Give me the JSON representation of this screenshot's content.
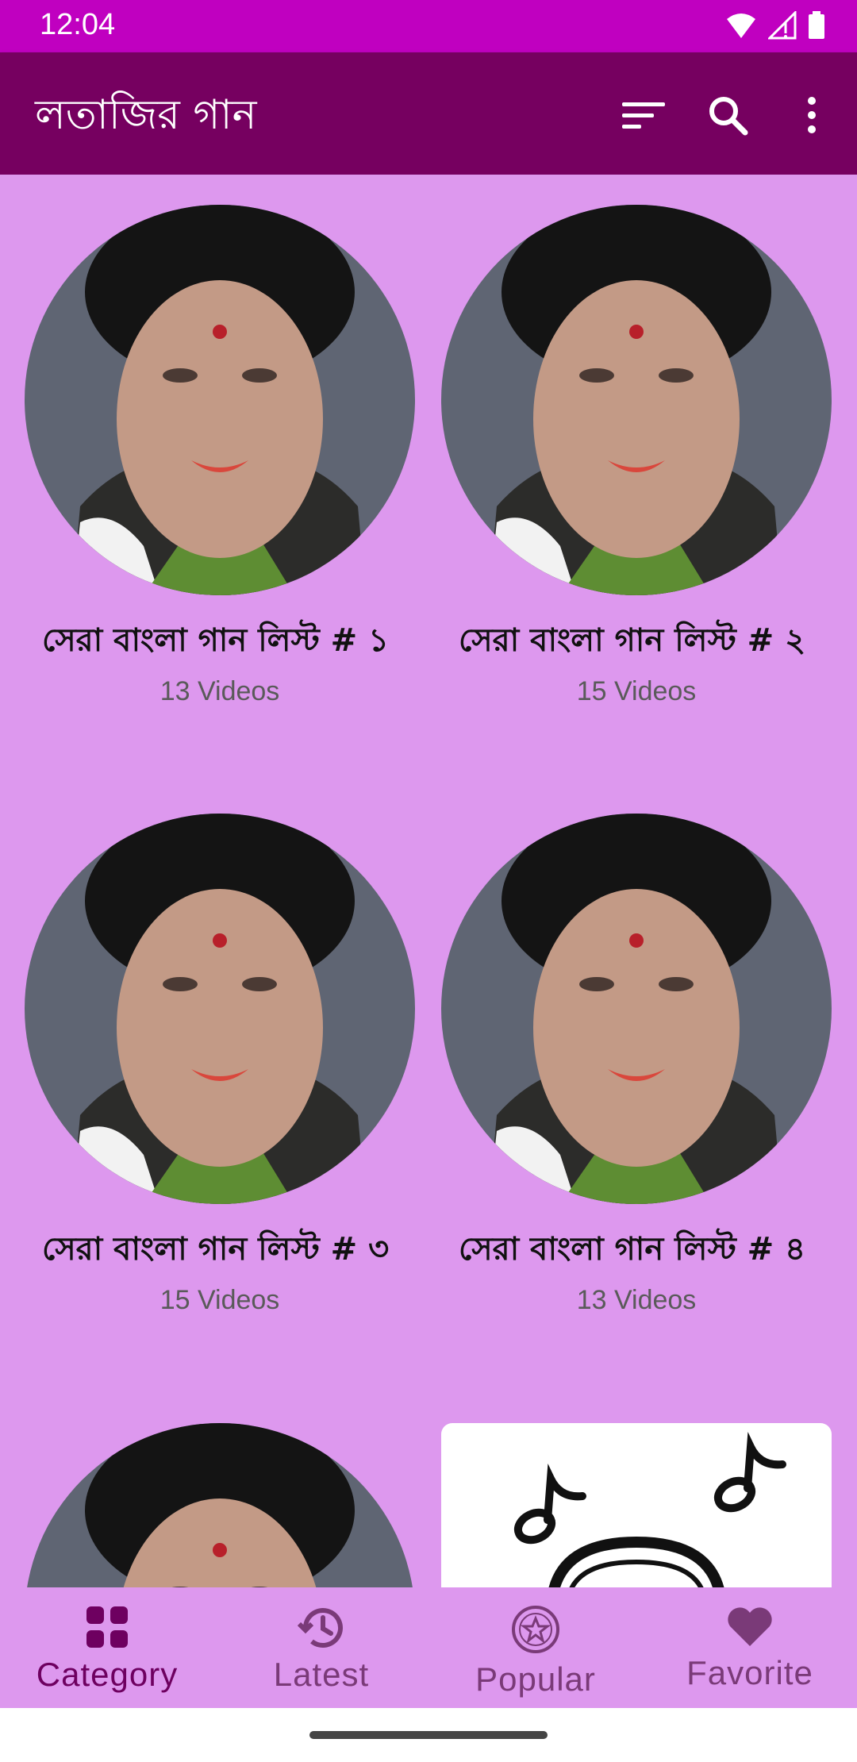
{
  "status": {
    "time": "12:04",
    "icons": [
      "wifi-icon",
      "cell-signal-icon",
      "battery-icon"
    ]
  },
  "appbar": {
    "title": "লতাজির গান",
    "actions": [
      "sort-icon",
      "search-icon",
      "more-vert-icon"
    ]
  },
  "categories": [
    {
      "title": "সেরা বাংলা গান লিস্ট # ১",
      "count": "13 Videos"
    },
    {
      "title": "সেরা বাংলা গান লিস্ট # ২",
      "count": "15 Videos"
    },
    {
      "title": "সেরা বাংলা গান লিস্ট # ৩",
      "count": "15 Videos"
    },
    {
      "title": "সেরা বাংলা গান লিস্ট # ৪",
      "count": "13 Videos"
    }
  ],
  "partial_card_icon": "music-notes-icon",
  "bottom_nav": [
    {
      "label": "Category",
      "icon": "grid-icon",
      "active": true
    },
    {
      "label": "Latest",
      "icon": "history-icon",
      "active": false
    },
    {
      "label": "Popular",
      "icon": "star-badge-icon",
      "active": false
    },
    {
      "label": "Favorite",
      "icon": "heart-icon",
      "active": false
    }
  ],
  "colors": {
    "status_bar": "#c000c0",
    "app_bar": "#760060",
    "background": "#dd98ee",
    "active_nav": "#6e0060",
    "inactive_nav": "#7a3a78"
  }
}
